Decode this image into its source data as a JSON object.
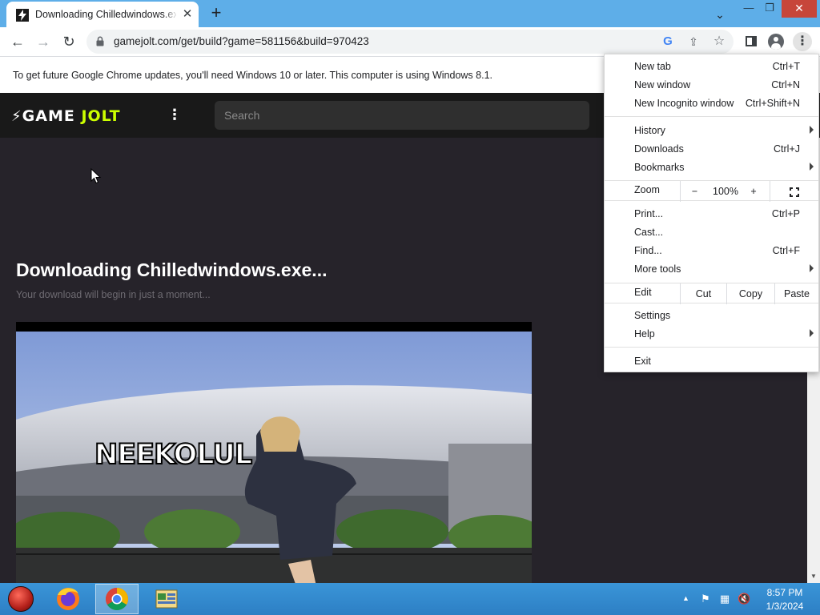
{
  "browser": {
    "tab": {
      "title": "Downloading Chilledwindows.exe...",
      "close_glyph": "✕",
      "favicon": "game-jolt-favicon"
    },
    "new_tab_glyph": "+",
    "tab_search_glyph": "⌄",
    "window_controls": {
      "minimize": "—",
      "restore": "❐",
      "close": "✕"
    },
    "nav": {
      "back": "←",
      "forward": "→",
      "reload": "↻"
    },
    "url": "gamejolt.com/get/build?game=581156&build=970423",
    "omnibox_icons": {
      "google": "G",
      "share": "⇪",
      "bookmark": "☆"
    },
    "menu_glyph": "⋮"
  },
  "infobar": {
    "message": "To get future Google Chrome updates, you'll need Windows 10 or later. This computer is using Windows 8.1."
  },
  "gamejolt": {
    "logo_bolt": "⚡",
    "logo_word1": "GAME",
    "logo_word2": "JOLT",
    "more_glyph": "⋮",
    "search_placeholder": "Search",
    "download_title": "Downloading Chilledwindows.exe...",
    "download_subtitle": "Your download will begin in just a moment...",
    "ad_caption": "NEEKOLUL",
    "scroll_down_glyph": "▼"
  },
  "chrome_menu": {
    "group1": [
      {
        "label": "New tab",
        "shortcut": "Ctrl+T"
      },
      {
        "label": "New window",
        "shortcut": "Ctrl+N"
      },
      {
        "label": "New Incognito window",
        "shortcut": "Ctrl+Shift+N"
      }
    ],
    "group2": [
      {
        "label": "History",
        "shortcut": ""
      },
      {
        "label": "Downloads",
        "shortcut": "Ctrl+J"
      },
      {
        "label": "Bookmarks",
        "shortcut": ""
      }
    ],
    "zoom": {
      "label": "Zoom",
      "minus": "−",
      "value": "100%",
      "plus": "+"
    },
    "group3": [
      {
        "label": "Print...",
        "shortcut": "Ctrl+P"
      },
      {
        "label": "Cast...",
        "shortcut": ""
      },
      {
        "label": "Find...",
        "shortcut": "Ctrl+F"
      },
      {
        "label": "More tools",
        "shortcut": ""
      }
    ],
    "edit": {
      "label": "Edit",
      "cut": "Cut",
      "copy": "Copy",
      "paste": "Paste"
    },
    "group4": [
      {
        "label": "Settings",
        "shortcut": ""
      },
      {
        "label": "Help",
        "shortcut": ""
      }
    ],
    "exit": "Exit"
  },
  "taskbar": {
    "apps": [
      "start-orb",
      "firefox",
      "chrome",
      "file-explorer"
    ],
    "tray_up": "▲",
    "tray_icons": {
      "flag": "⚑",
      "network": "▦",
      "volume": "🔇"
    },
    "time": "8:57 PM",
    "date": "1/3/2024"
  },
  "colors": {
    "titlebar": "#5eaee8",
    "page_bg": "#26232a",
    "gamejolt_accent": "#ccff00",
    "close_button": "#c7463a",
    "taskbar": "#3a95d8"
  }
}
